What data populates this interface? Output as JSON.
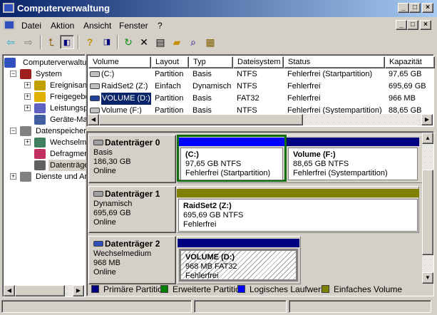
{
  "window": {
    "title": "Computerverwaltung",
    "buttons": [
      "_",
      "□",
      "×"
    ]
  },
  "menu": {
    "items": [
      "Datei",
      "Aktion",
      "Ansicht",
      "Fenster",
      "?"
    ],
    "mdi_buttons": [
      "_",
      "□",
      "×"
    ]
  },
  "toolbar": {
    "icons": [
      "back-icon",
      "forward-icon",
      "up-folder-icon",
      "show-hide-tree-icon",
      "help-icon",
      "show-hide-action-pane-icon",
      "refresh-icon",
      "delete-icon",
      "properties-icon",
      "open-icon",
      "search-icon",
      "settings-icon"
    ]
  },
  "tree": {
    "items": [
      {
        "label": "Computerverwaltung",
        "level": 0,
        "expander": ""
      },
      {
        "label": "System",
        "level": 1,
        "expander": "−"
      },
      {
        "label": "Ereignisanzeige",
        "level": 2,
        "expander": "+"
      },
      {
        "label": "Freigegebene Ordner",
        "level": 2,
        "expander": "+"
      },
      {
        "label": "Leistungsprotokolle",
        "level": 2,
        "expander": "+"
      },
      {
        "label": "Geräte-Manager",
        "level": 2,
        "expander": ""
      },
      {
        "label": "Datenspeicher",
        "level": 1,
        "expander": "−"
      },
      {
        "label": "Wechselmedien",
        "level": 2,
        "expander": "+"
      },
      {
        "label": "Defragmentierung",
        "level": 2,
        "expander": ""
      },
      {
        "label": "Datenträgerverwaltung",
        "level": 2,
        "expander": "",
        "selected": true
      },
      {
        "label": "Dienste und Anwendungen",
        "level": 1,
        "expander": "+"
      }
    ]
  },
  "list": {
    "columns": [
      "Volume",
      "Layout",
      "Typ",
      "Dateisystem",
      "Status",
      "Kapazität"
    ],
    "rows": [
      [
        "(C:)",
        "Partition",
        "Basis",
        "NTFS",
        "Fehlerfrei (Startpartition)",
        "97,65 GB"
      ],
      [
        "RaidSet2 (Z:)",
        "Einfach",
        "Dynamisch",
        "NTFS",
        "Fehlerfrei",
        "695,69 GB"
      ],
      [
        "VOLUME (D:)",
        "Partition",
        "Basis",
        "FAT32",
        "Fehlerfrei",
        "966 MB"
      ],
      [
        "Volume (F:)",
        "Partition",
        "Basis",
        "NTFS",
        "Fehlerfrei (Systempartition)",
        "88,65 GB"
      ]
    ],
    "selected_row": 2
  },
  "disks": [
    {
      "name": "Datenträger 0",
      "type": "Basis",
      "size": "186,30 GB",
      "state": "Online",
      "partitions": [
        {
          "name": "(C:)",
          "detail": "97,65 GB NTFS",
          "status": "Fehlerfrei (Startpartition)"
        },
        {
          "name": "Volume  (F:)",
          "detail": "88,65 GB NTFS",
          "status": "Fehlerfrei (Systempartition)"
        }
      ]
    },
    {
      "name": "Datenträger 1",
      "type": "Dynamisch",
      "size": "695,69 GB",
      "state": "Online",
      "partitions": [
        {
          "name": "RaidSet2  (Z:)",
          "detail": "695,69 GB NTFS",
          "status": "Fehlerfrei"
        }
      ]
    },
    {
      "name": "Datenträger 2",
      "type": "Wechselmedium",
      "size": "968 MB",
      "state": "Online",
      "partitions": [
        {
          "name": "VOLUME  (D:)",
          "detail": "968 MB FAT32",
          "status": "Fehlerfrei"
        }
      ]
    }
  ],
  "legend": [
    {
      "label": "Primäre Partition",
      "color": "#000080"
    },
    {
      "label": "Erweiterte Partition",
      "color": "#008000"
    },
    {
      "label": "Logisches Laufwerk",
      "color": "#0000ff"
    },
    {
      "label": "Einfaches Volume",
      "color": "#808000"
    }
  ]
}
